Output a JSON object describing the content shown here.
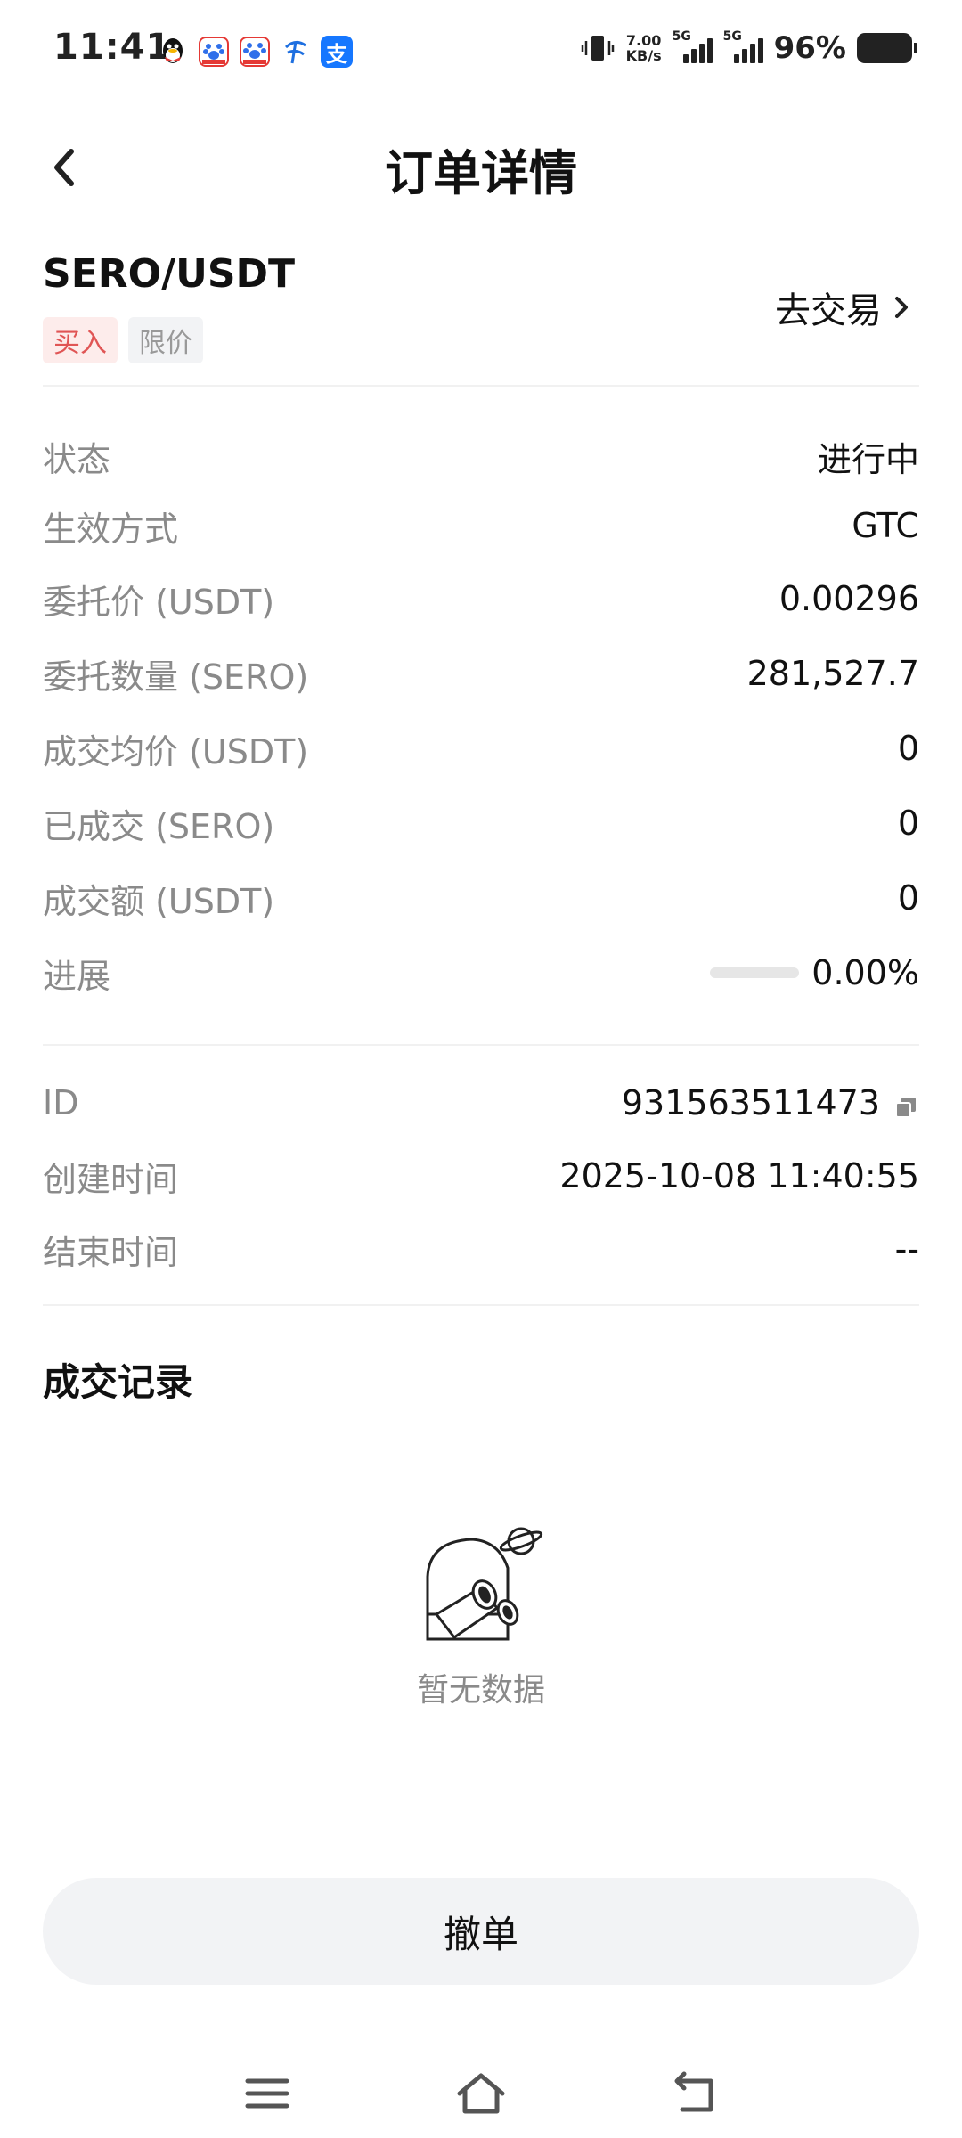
{
  "status_bar": {
    "time": "11:41",
    "net_speed_value": "7.00",
    "net_speed_unit": "KB/s",
    "signal1_label": "5G",
    "signal2_label": "5G",
    "battery": "96%",
    "app_icons": [
      "qq-icon",
      "baidu-netdisk-icon",
      "baidu-map-icon",
      "china-telecom-icon",
      "alipay-icon"
    ]
  },
  "nav": {
    "title": "订单详情"
  },
  "order": {
    "pair": "SERO/USDT",
    "side_tag": "买入",
    "type_tag": "限价",
    "go_trade": "去交易"
  },
  "details": [
    {
      "key": "状态",
      "value": "进行中"
    },
    {
      "key": "生效方式",
      "value": "GTC"
    },
    {
      "key": "委托价 (USDT)",
      "value": "0.00296"
    },
    {
      "key": "委托数量 (SERO)",
      "value": "281,527.7"
    },
    {
      "key": "成交均价 (USDT)",
      "value": "0"
    },
    {
      "key": "已成交 (SERO)",
      "value": "0"
    },
    {
      "key": "成交额 (USDT)",
      "value": "0"
    }
  ],
  "progress": {
    "key": "进展",
    "value": "0.00%",
    "fraction": 0.0
  },
  "meta": [
    {
      "key": "ID",
      "value": "931563511473"
    },
    {
      "key": "创建时间",
      "value": "2025-10-08 11:40:55"
    },
    {
      "key": "结束时间",
      "value": "--"
    }
  ],
  "trades": {
    "title": "成交记录",
    "empty_text": "暂无数据"
  },
  "actions": {
    "cancel_label": "撤单"
  },
  "colors": {
    "buy_red": "#e05555",
    "buy_bg": "#fdeceb",
    "muted": "#8a8a8a",
    "button_bg": "#f2f3f5"
  }
}
